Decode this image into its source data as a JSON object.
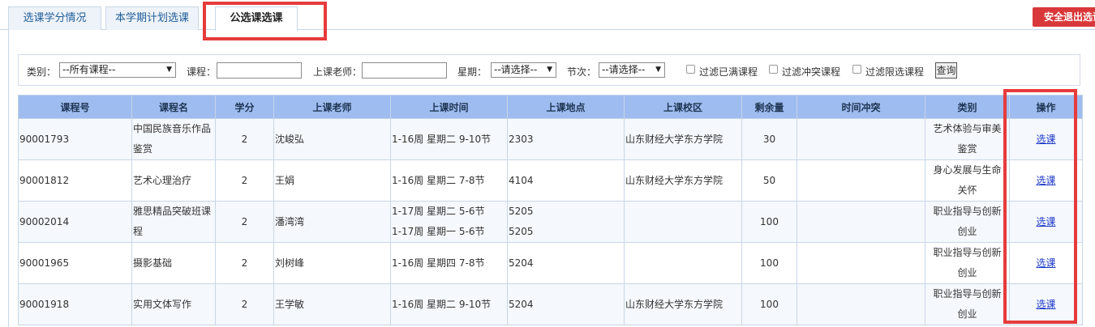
{
  "tabs": [
    {
      "label": "选课学分情况"
    },
    {
      "label": "本学期计划选课"
    },
    {
      "label": "公选课选课"
    }
  ],
  "exit_button": "安全退出选课",
  "filter": {
    "category_label": "类别：",
    "category_value": "--所有课程--",
    "course_label": "课程：",
    "teacher_label": "上课老师：",
    "weekday_label": "星期：",
    "weekday_value": "--请选择--",
    "period_label": "节次：",
    "period_value": "--请选择--",
    "filter_full": "过滤已满课程",
    "filter_conflict": "过滤冲突课程",
    "filter_limited": "过滤限选课程",
    "query_button": "查询"
  },
  "table": {
    "headers": [
      "课程号",
      "课程名",
      "学分",
      "上课老师",
      "上课时间",
      "上课地点",
      "上课校区",
      "剩余量",
      "时间冲突",
      "类别",
      "操作"
    ],
    "rows": [
      {
        "id": "90001793",
        "name_lines": [
          "中国民族音乐作品",
          "鉴赏"
        ],
        "credit": "2",
        "teacher": "沈峻弘",
        "time_lines": [
          "1-16周 星期二 9-10节"
        ],
        "place_lines": [
          "2303"
        ],
        "campus": "山东财经大学东方学院",
        "remain": "30",
        "conflict": "",
        "category_lines": [
          "艺术体验与审美",
          "鉴赏"
        ],
        "action": "选课"
      },
      {
        "id": "90001812",
        "name_lines": [
          "艺术心理治疗"
        ],
        "credit": "2",
        "teacher": "王娟",
        "time_lines": [
          "1-16周 星期二 7-8节"
        ],
        "place_lines": [
          "4104"
        ],
        "campus": "山东财经大学东方学院",
        "remain": "50",
        "conflict": "",
        "category_lines": [
          "身心发展与生命",
          "关怀"
        ],
        "action": "选课"
      },
      {
        "id": "90002014",
        "name_lines": [
          "雅思精品突破班课",
          "程"
        ],
        "credit": "2",
        "teacher": "潘湾湾",
        "time_lines": [
          "1-17周 星期二 5-6节",
          "1-17周 星期一 5-6节"
        ],
        "place_lines": [
          "5205",
          "5205"
        ],
        "campus": "",
        "remain": "100",
        "conflict": "",
        "category_lines": [
          "职业指导与创新",
          "创业"
        ],
        "action": "选课"
      },
      {
        "id": "90001965",
        "name_lines": [
          "摄影基础"
        ],
        "credit": "2",
        "teacher": "刘树峰",
        "time_lines": [
          "1-16周 星期四 7-8节"
        ],
        "place_lines": [
          "5204"
        ],
        "campus": "",
        "remain": "100",
        "conflict": "",
        "category_lines": [
          "职业指导与创新",
          "创业"
        ],
        "action": "选课"
      },
      {
        "id": "90001918",
        "name_lines": [
          "实用文体写作"
        ],
        "credit": "2",
        "teacher": "王学敏",
        "time_lines": [
          "1-16周 星期二 9-10节"
        ],
        "place_lines": [
          "5204"
        ],
        "campus": "山东财经大学东方学院",
        "remain": "100",
        "conflict": "",
        "category_lines": [
          "职业指导与创新",
          "创业"
        ],
        "action": "选课"
      }
    ]
  },
  "colors": {
    "header_bg": "#9fbcf0",
    "highlight_red": "#e63b3b",
    "exit_button": "#d9383a",
    "link": "#1a36c9"
  }
}
